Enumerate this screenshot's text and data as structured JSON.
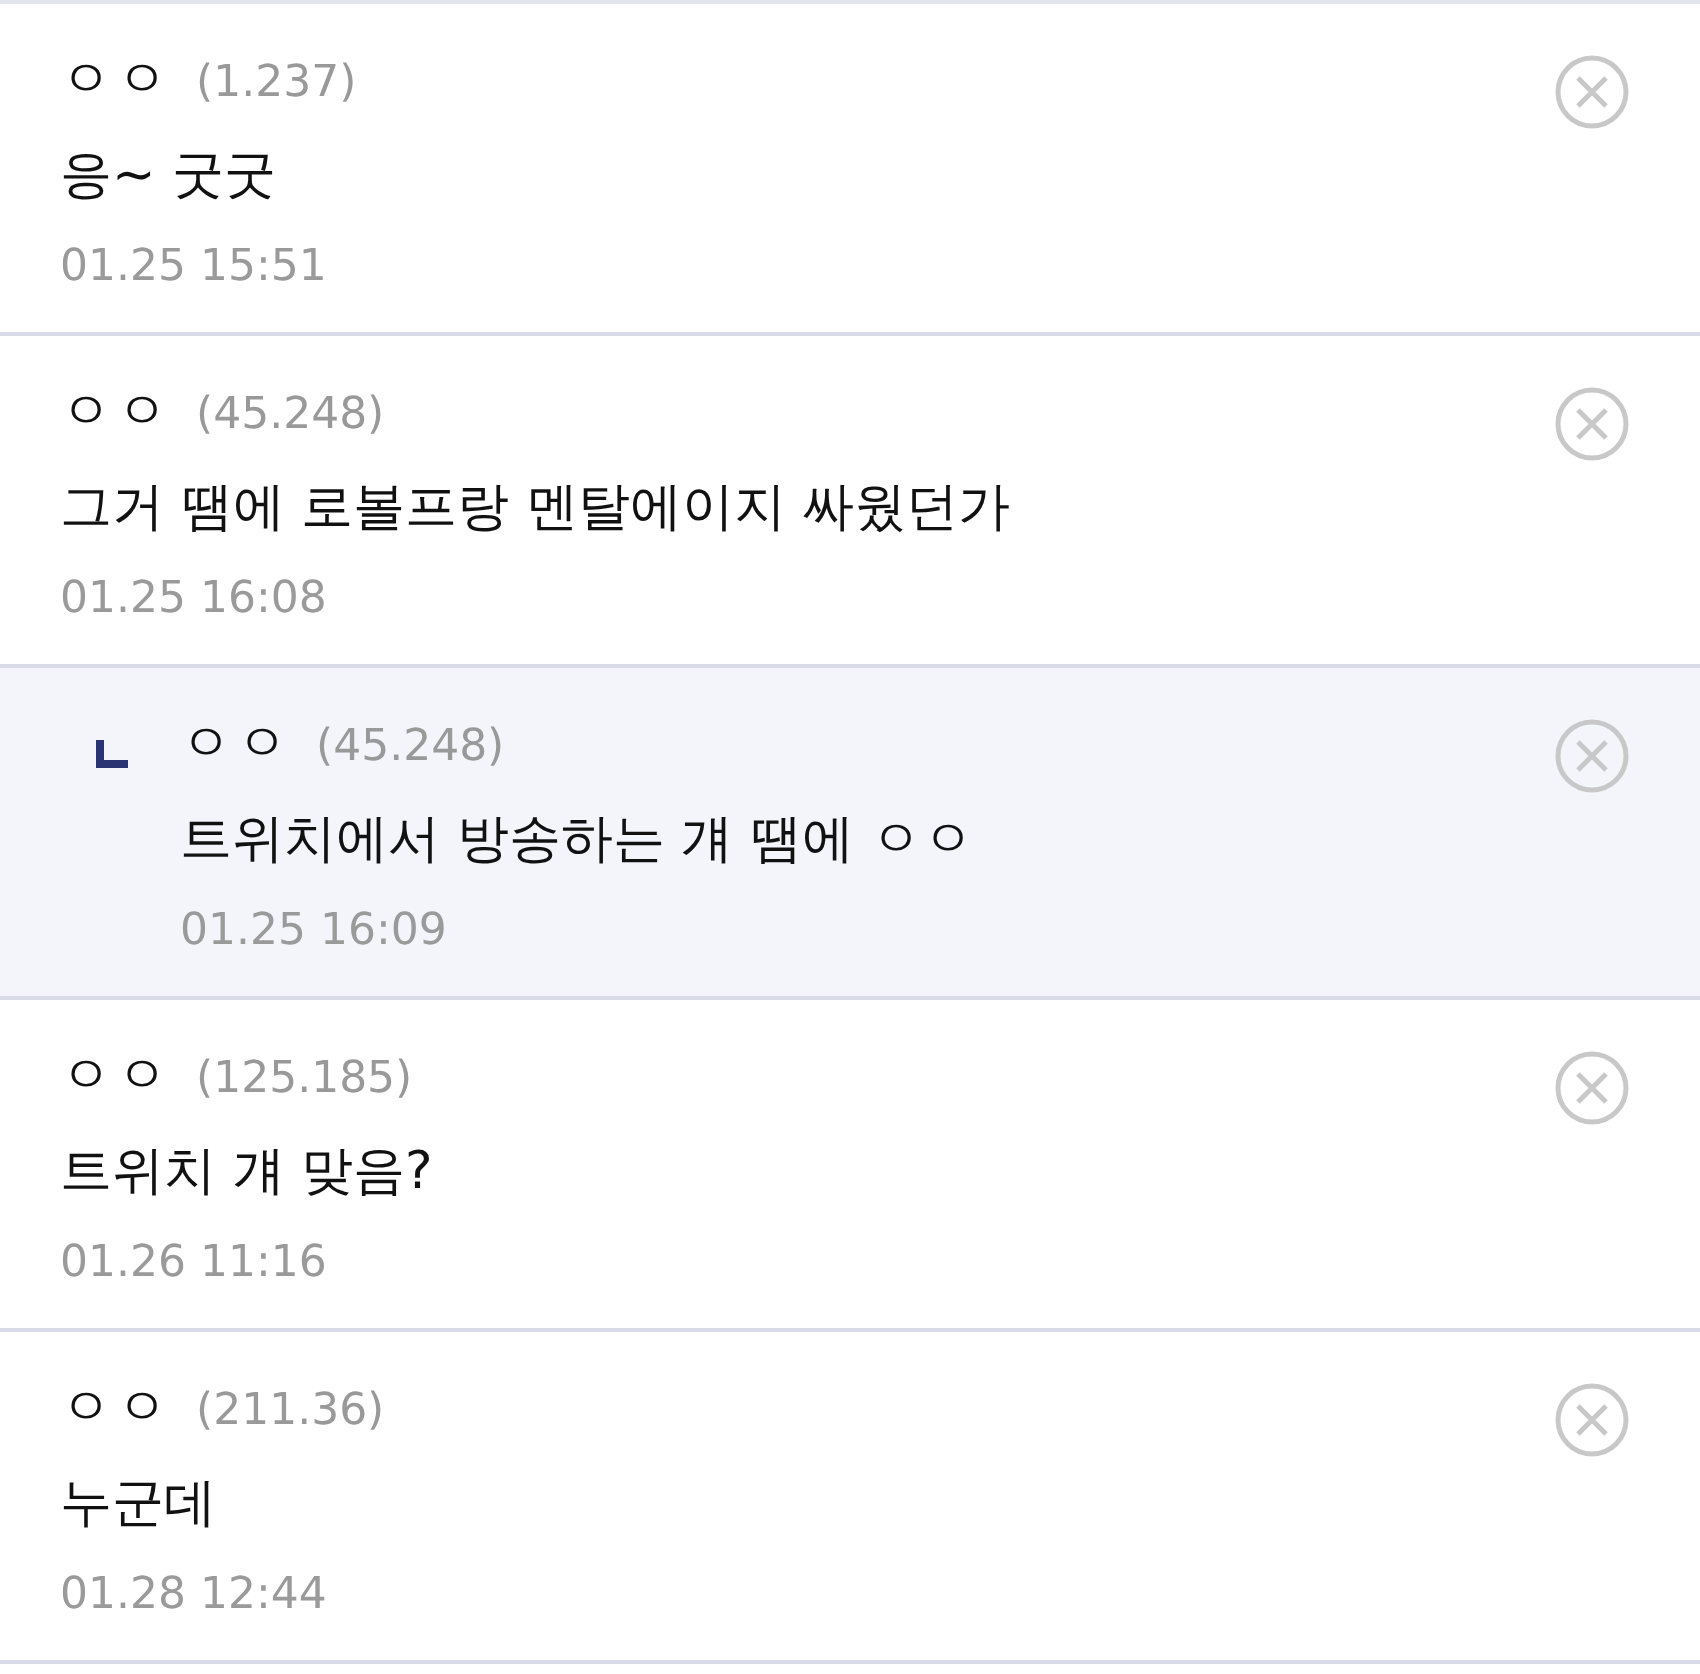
{
  "comments": [
    {
      "kind": "comment",
      "nickname": "ㅇㅇ",
      "ip": "(1.237)",
      "text": "응~ 굿굿",
      "date": "01.25 15:51"
    },
    {
      "kind": "comment",
      "nickname": "ㅇㅇ",
      "ip": "(45.248)",
      "text": "그거 땜에 로볼프랑 멘탈에이지 싸웠던가",
      "date": "01.25 16:08"
    },
    {
      "kind": "reply",
      "nickname": "ㅇㅇ",
      "ip": "(45.248)",
      "text": "트위치에서 방송하는 걔 땜에 ㅇㅇ",
      "date": "01.25 16:09"
    },
    {
      "kind": "comment",
      "nickname": "ㅇㅇ",
      "ip": "(125.185)",
      "text": "트위치 걔 맞음?",
      "date": "01.26 11:16"
    },
    {
      "kind": "comment",
      "nickname": "ㅇㅇ",
      "ip": "(211.36)",
      "text": "누군데",
      "date": "01.28 12:44"
    }
  ]
}
